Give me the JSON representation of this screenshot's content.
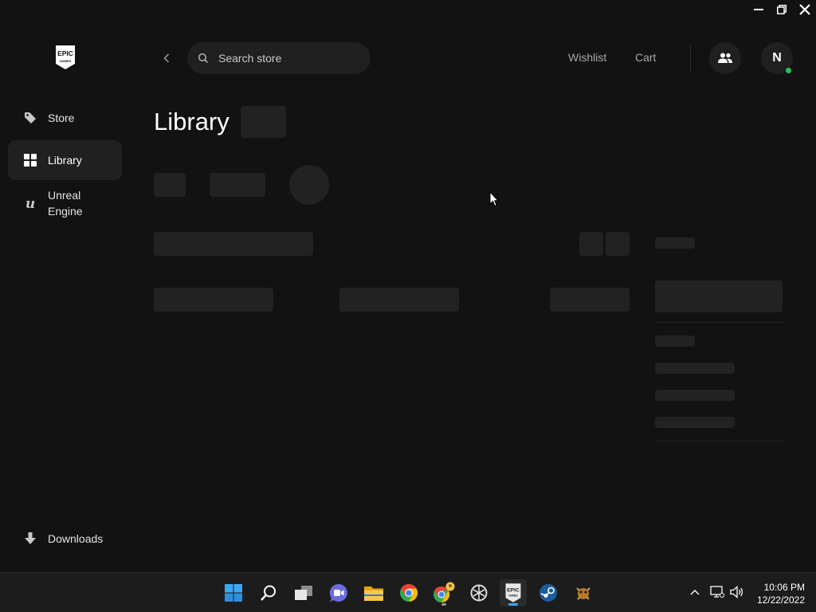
{
  "nav": {
    "store": "Store",
    "library": "Library",
    "unreal": "Unreal Engine",
    "downloads": "Downloads"
  },
  "logo": {
    "line1": "EPIC",
    "line2": "GAMES"
  },
  "search": {
    "placeholder": "Search store"
  },
  "header": {
    "wishlist": "Wishlist",
    "cart": "Cart",
    "avatar_initial": "N",
    "status_color": "#22c55e"
  },
  "page": {
    "title": "Library"
  },
  "taskbar": {
    "apps": [
      "start-icon",
      "search-icon",
      "task-view-icon",
      "teams-chat-icon",
      "file-explorer-icon",
      "chrome-icon",
      "chrome-profile-icon",
      "app-icon",
      "epic-games-icon",
      "steam-icon",
      "game-icon"
    ],
    "time": "10:06 PM",
    "date": "12/22/2022"
  },
  "colors": {
    "background": "#121212",
    "surface": "#202020",
    "skeleton": "#222222"
  }
}
